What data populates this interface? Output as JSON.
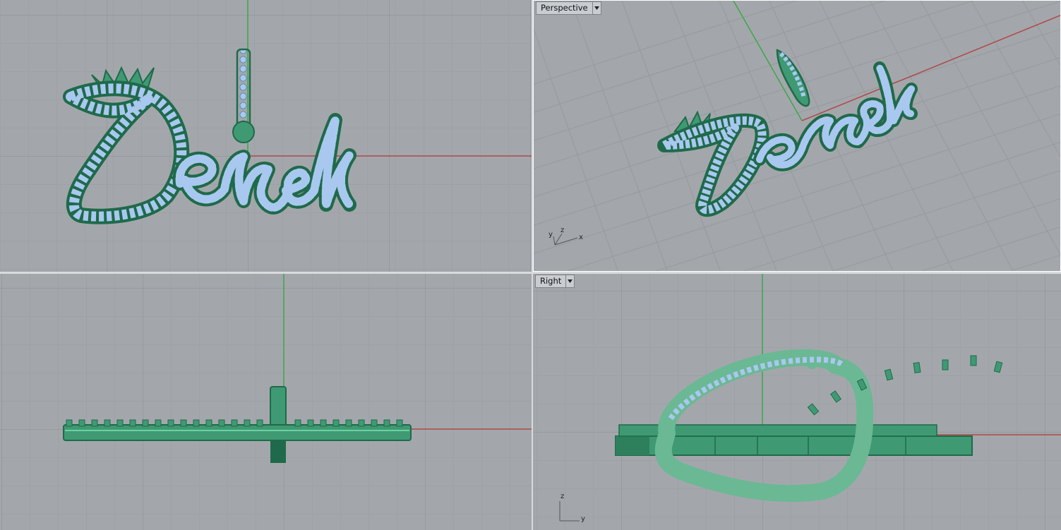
{
  "viewports": {
    "top": {
      "label": "",
      "model_text": "Derek"
    },
    "perspective": {
      "label": "Perspective",
      "model_text": "Derek",
      "axes": {
        "x": "x",
        "y": "y",
        "z": "z"
      }
    },
    "front": {
      "label": ""
    },
    "right": {
      "label": "Right",
      "axes": {
        "y": "y",
        "z": "z"
      }
    }
  },
  "colors": {
    "background": "#a3a7ab",
    "grid_minor": "#9a9ea2",
    "grid_major": "#8b8f93",
    "axis_x": "#b04848",
    "axis_y": "#3aa84a",
    "metal": "#3f9a73",
    "metal_dark": "#1f6a4a",
    "gem": "#a9c8f0",
    "label_bg": "#c9ccd0"
  },
  "icons": {
    "dropdown": "chevron-down-icon",
    "axis": "axis-gizmo-icon"
  }
}
